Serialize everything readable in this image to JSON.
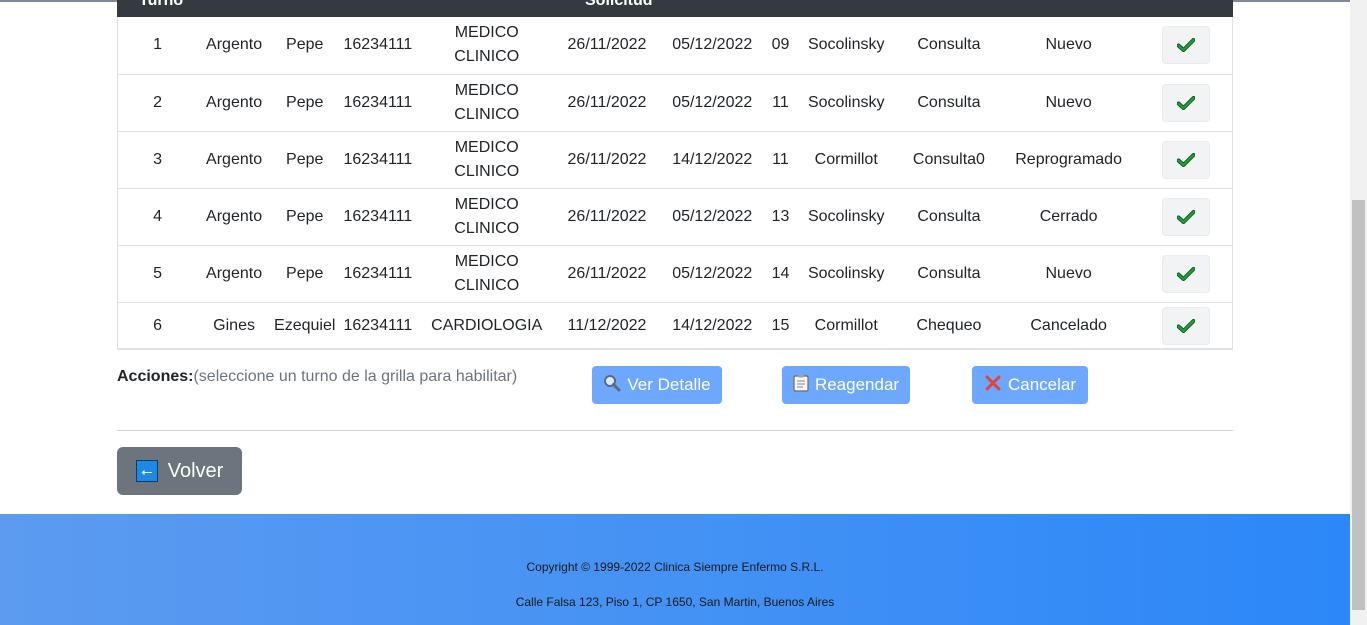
{
  "table": {
    "header": {
      "turno": "Turno",
      "solicitud": "Solicitud"
    },
    "rows": [
      {
        "turno": "1",
        "apellido": "Argento",
        "nombre": "Pepe",
        "dni": "16234111",
        "esp1": "MEDICO",
        "esp2": "CLINICO",
        "solicitud": "26/11/2022",
        "fecha": "05/12/2022",
        "hora": "09",
        "medico": "Socolinsky",
        "tipo": "Consulta",
        "estado": "Nuevo"
      },
      {
        "turno": "2",
        "apellido": "Argento",
        "nombre": "Pepe",
        "dni": "16234111",
        "esp1": "MEDICO",
        "esp2": "CLINICO",
        "solicitud": "26/11/2022",
        "fecha": "05/12/2022",
        "hora": "11",
        "medico": "Socolinsky",
        "tipo": "Consulta",
        "estado": "Nuevo"
      },
      {
        "turno": "3",
        "apellido": "Argento",
        "nombre": "Pepe",
        "dni": "16234111",
        "esp1": "MEDICO",
        "esp2": "CLINICO",
        "solicitud": "26/11/2022",
        "fecha": "14/12/2022",
        "hora": "11",
        "medico": "Cormillot",
        "tipo": "Consulta0",
        "estado": "Reprogramado"
      },
      {
        "turno": "4",
        "apellido": "Argento",
        "nombre": "Pepe",
        "dni": "16234111",
        "esp1": "MEDICO",
        "esp2": "CLINICO",
        "solicitud": "26/11/2022",
        "fecha": "05/12/2022",
        "hora": "13",
        "medico": "Socolinsky",
        "tipo": "Consulta",
        "estado": "Cerrado"
      },
      {
        "turno": "5",
        "apellido": "Argento",
        "nombre": "Pepe",
        "dni": "16234111",
        "esp1": "MEDICO",
        "esp2": "CLINICO",
        "solicitud": "26/11/2022",
        "fecha": "05/12/2022",
        "hora": "14",
        "medico": "Socolinsky",
        "tipo": "Consulta",
        "estado": "Nuevo"
      },
      {
        "turno": "6",
        "apellido": "Gines",
        "nombre": "Ezequiel",
        "dni": "16234111",
        "esp1": "CARDIOLOGIA",
        "esp2": "",
        "solicitud": "11/12/2022",
        "fecha": "14/12/2022",
        "hora": "15",
        "medico": "Cormillot",
        "tipo": "Chequeo",
        "estado": "Cancelado"
      }
    ],
    "select_icon": "check-icon"
  },
  "actions": {
    "label": "Acciones:",
    "hint": "(seleccione un turno de la grilla para habilitar)",
    "ver_detalle": "Ver Detalle",
    "reagendar": "Reagendar",
    "cancelar": "Cancelar"
  },
  "volver": {
    "label": "Volver",
    "arrow": "⭠"
  },
  "footer": {
    "copyright": "Copyright © 1999-2022 Clinica Siempre Enfermo S.R.L.",
    "address": "Calle Falsa 123, Piso 1, CP 1650, San Martin, Buenos Aires"
  },
  "colors": {
    "button_primary": "#6ea8fe",
    "button_secondary": "#6c757d",
    "header_dark": "#343a40",
    "footer_blue": "#3f90f5",
    "check_green": "#1b8a2e"
  }
}
